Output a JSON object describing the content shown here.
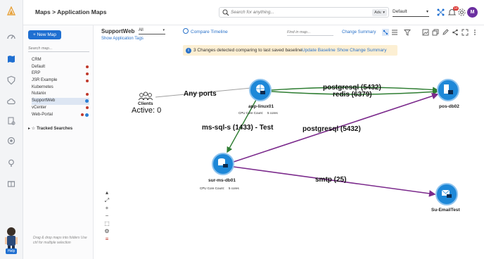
{
  "header": {
    "breadcrumb": "Maps > Application Maps",
    "search_placeholder": "Search for anything...",
    "adv_label": "Adv. ▾",
    "default_select": "Default",
    "notification_count": "10",
    "avatar_initial": "M"
  },
  "sidebar": {
    "new_map_label": "+ New Map",
    "search_placeholder": "Search map...",
    "maps": [
      {
        "label": "CRM",
        "indicator": "none"
      },
      {
        "label": "Default",
        "indicator": "red"
      },
      {
        "label": "ERP",
        "indicator": "red"
      },
      {
        "label": "JSR Example",
        "indicator": "red"
      },
      {
        "label": "Kubernetes",
        "indicator": "none"
      },
      {
        "label": "Nutanix",
        "indicator": "red"
      },
      {
        "label": "SupportWeb",
        "indicator": "blue"
      },
      {
        "label": "vCenter",
        "indicator": "red"
      },
      {
        "label": "Web-Portal",
        "indicator": "red-blue"
      }
    ],
    "selected_map": "SupportWeb",
    "tracked_searches_label": "Tracked Searches",
    "hint": "Drag & drop maps into folders Use ctrl for multiple selection"
  },
  "map": {
    "title": "SupportWeb",
    "filter_value": "All",
    "show_tags_label": "Show Application Tags",
    "compare_timeline_label": "Compare Timeline",
    "find_placeholder": "Find in map...",
    "change_summary_label": "Change Summary",
    "banner": {
      "info": "i",
      "message": "3 Changes detected comparing to last saved baseline",
      "update_baseline": "Update Baseline",
      "show_change_summary": "Show Change Summary"
    },
    "nodes": {
      "clients": {
        "label": "Clients",
        "active": "Active: 0"
      },
      "app_linux": {
        "label": "app-linux01",
        "cpu_label": "CPU Core Count:",
        "cpu_value": "5 cores"
      },
      "pos_db": {
        "label": "pos-db02"
      },
      "sur_ms_db": {
        "label": "sur-ms-db01",
        "cpu_label": "CPU Core Count:",
        "cpu_value": "5 cores"
      },
      "email": {
        "label": "Su-EmailTest"
      }
    },
    "edges": {
      "any_ports": "Any ports",
      "postgresql_top": "postgresql (5432)",
      "redis": "redis (6379)",
      "ms_sql": "ms-sql-s (1433) - Test",
      "postgresql_mid": "postgresql (5432)",
      "smtp": "smtp (25)"
    },
    "colors": {
      "node_blue": "#1e88d8",
      "edge_green": "#2e7d32",
      "edge_purple": "#7b2a8c",
      "edge_grey": "#a0a0a0"
    }
  },
  "help_label": "Help"
}
